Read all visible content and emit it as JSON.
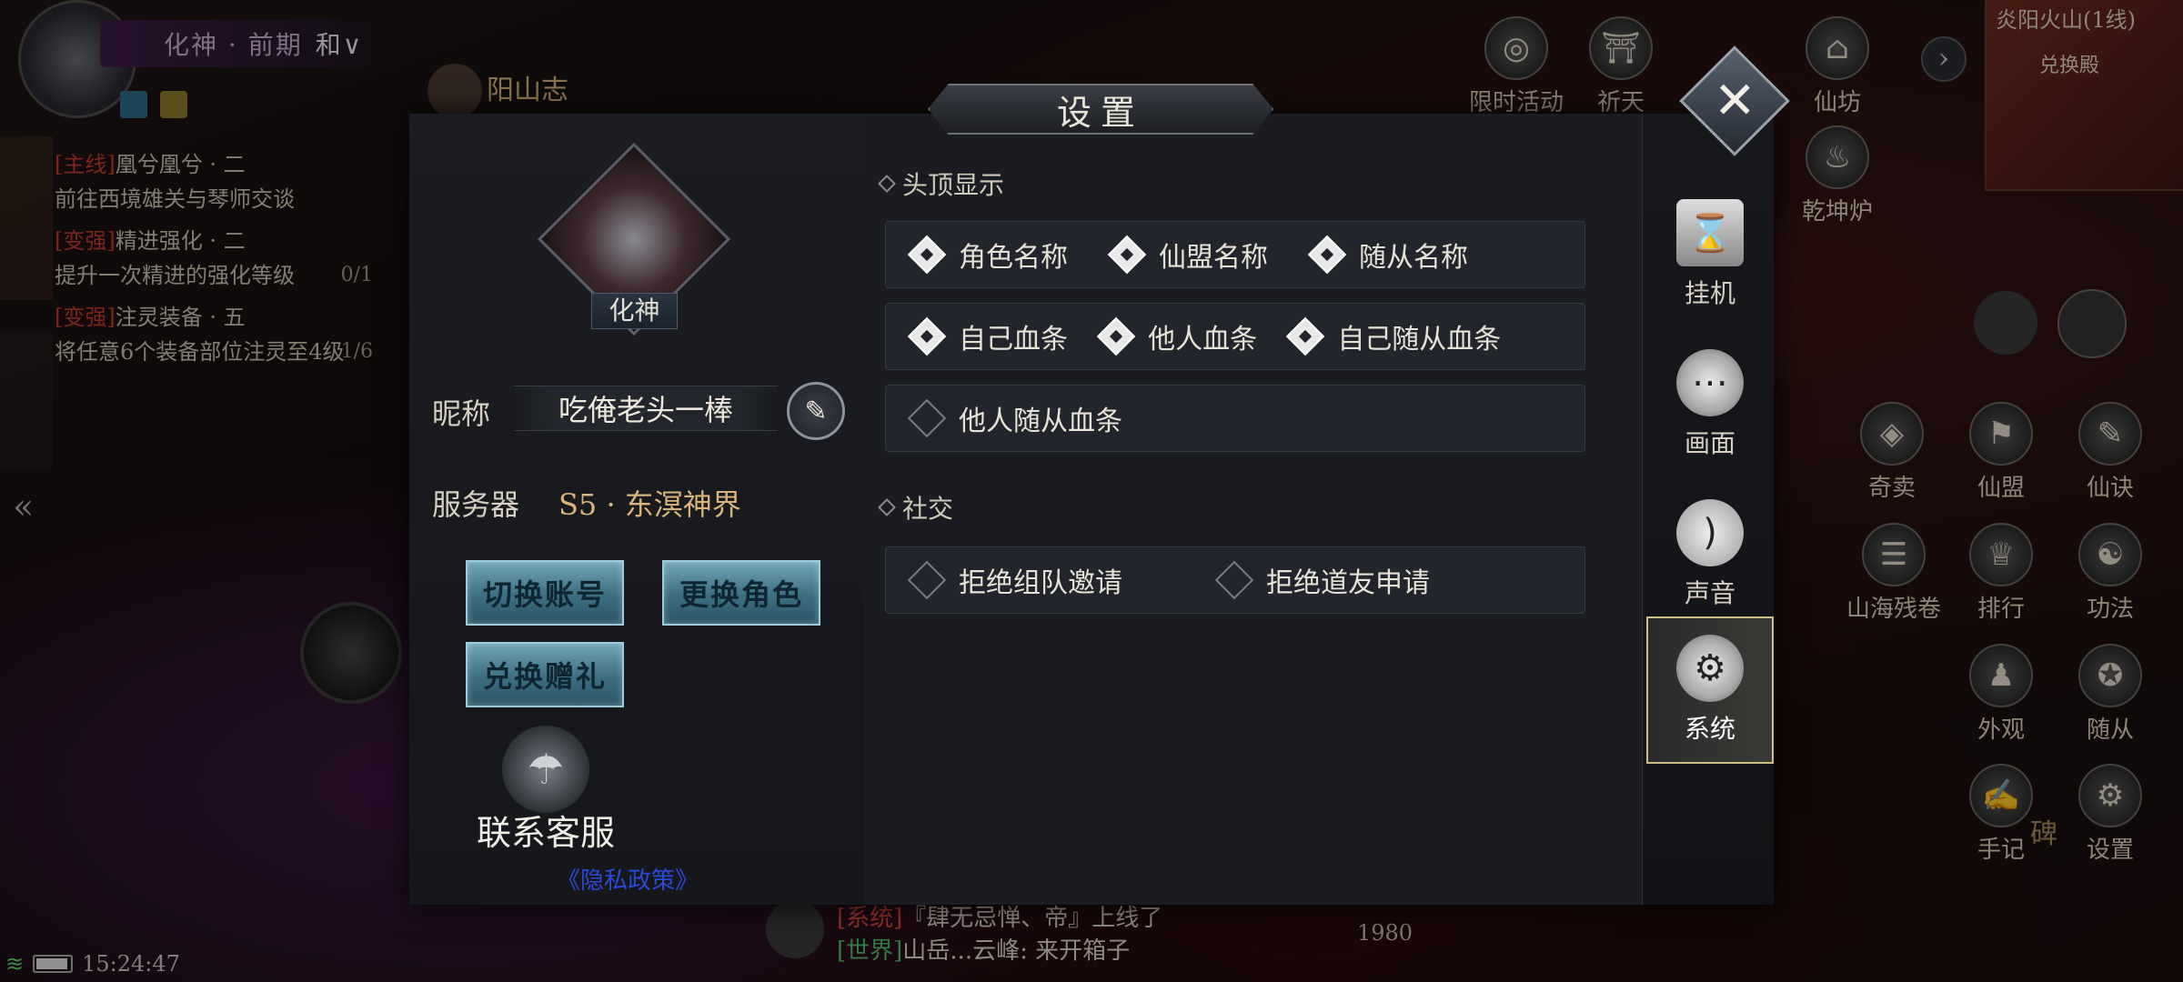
{
  "hud": {
    "realm": "化神 · 前期",
    "peace_mode": "和∨",
    "location_banner": "阳山志",
    "quests": [
      {
        "tag": "[主线]",
        "title": "凰兮凰兮 · 二",
        "desc": "前往西境雄关与琴师交谈",
        "progress": ""
      },
      {
        "tag": "[变强]",
        "title": "精进强化 · 二",
        "desc": "提升一次精进的强化等级",
        "progress": "0/1"
      },
      {
        "tag": "[变强]",
        "title": "注灵装备 · 五",
        "desc": "将任意6个装备部位注灵至4级",
        "progress": "1/6"
      }
    ],
    "top_icons": [
      {
        "name": "limited-event",
        "label": "限时活动"
      },
      {
        "name": "pray",
        "label": "祈天"
      },
      {
        "name": "xianfang",
        "label": "仙坊"
      }
    ],
    "qiankun_label": "乾坤炉",
    "minimap": {
      "title": "炎阳火山(1线)",
      "location": "兑换殿"
    },
    "side_icons": [
      {
        "label": "奇卖"
      },
      {
        "label": "仙盟"
      },
      {
        "label": "仙诀"
      },
      {
        "label": "山海残卷"
      },
      {
        "label": "排行"
      },
      {
        "label": "功法"
      },
      {
        "label": "外观"
      },
      {
        "label": "随从"
      },
      {
        "label": "手记"
      },
      {
        "label": "设置"
      }
    ],
    "stone_label": "碑",
    "status_time": "15:24:47",
    "chat": {
      "line1_tag": "[系统]",
      "line1": "『肆无忌惮、帝』上线了",
      "line2_tag": "[世界]",
      "line2": "山岳...云峰: 来开箱子"
    },
    "chat_count": "1980"
  },
  "dialog": {
    "title": "设置",
    "portrait_label": "化神",
    "nickname_label": "昵称",
    "nickname": "吃俺老头一棒",
    "server_label": "服务器",
    "server": "S5 · 东溟神界",
    "buttons": {
      "switch_account": "切换账号",
      "change_role": "更换角色",
      "redeem_gift": "兑换赠礼"
    },
    "contact_service": "联系客服",
    "privacy": "《隐私政策》",
    "section_head": "头顶显示",
    "section_social": "社交",
    "head_options": [
      {
        "label": "角色名称",
        "checked": true
      },
      {
        "label": "仙盟名称",
        "checked": true
      },
      {
        "label": "随从名称",
        "checked": true
      },
      {
        "label": "自己血条",
        "checked": true
      },
      {
        "label": "他人血条",
        "checked": true
      },
      {
        "label": "自己随从血条",
        "checked": true
      },
      {
        "label": "他人随从血条",
        "checked": false
      }
    ],
    "social_options": [
      {
        "label": "拒绝组队邀请",
        "checked": false
      },
      {
        "label": "拒绝道友申请",
        "checked": false
      }
    ],
    "tabs": [
      {
        "label": "挂机",
        "icon": "hourglass-icon"
      },
      {
        "label": "画面",
        "icon": "screen-icon"
      },
      {
        "label": "声音",
        "icon": "ear-icon"
      },
      {
        "label": "系统",
        "icon": "gear-icon",
        "active": true
      }
    ]
  }
}
